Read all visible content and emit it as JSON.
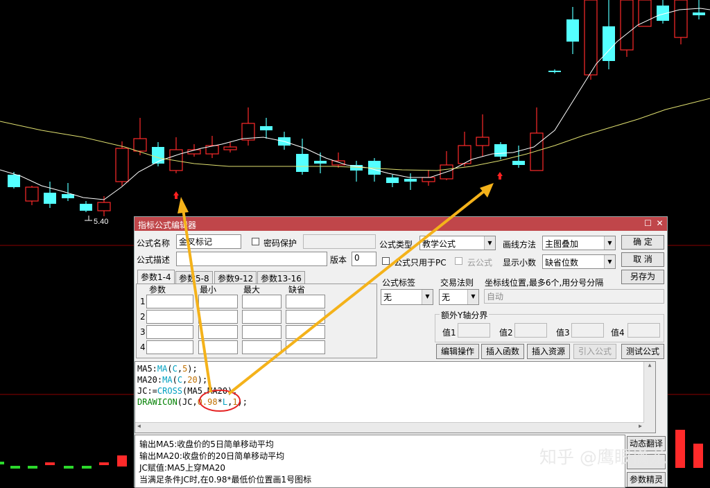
{
  "chart": {
    "low_price_label": "5.40",
    "colors": {
      "up": "#ff2a2a",
      "down": "#54ffff",
      "ma": "#ffffff",
      "ma20": "#e0e070",
      "signal": "#ff2020",
      "arrow": "#f4b21a",
      "divider": "#8b0000"
    }
  },
  "dialog": {
    "title": "指标公式编辑器",
    "name_label": "公式名称",
    "name_value": "金叉标记",
    "password_label": "密码保护",
    "type_label": "公式类型",
    "type_value": "教学公式",
    "draw_label": "画线方法",
    "draw_value": "主图叠加",
    "ok_label": "确  定",
    "cancel_label": "取  消",
    "saveas_label": "另存为",
    "desc_label": "公式描述",
    "version_label": "版本",
    "version_value": "0",
    "pc_only_label": "公式只用于PC",
    "cloud_label": "云公式",
    "decimals_label": "显示小数",
    "decimals_value": "缺省位数",
    "tabs": [
      "参数1-4",
      "参数5-8",
      "参数9-12",
      "参数13-16"
    ],
    "param_headers": [
      "参数",
      "最小",
      "最大",
      "缺省"
    ],
    "param_rows": [
      "1",
      "2",
      "3",
      "4"
    ],
    "formula_tag_label": "公式标签",
    "formula_tag_value": "无",
    "trade_rule_label": "交易法则",
    "trade_rule_value": "无",
    "axis_label": "坐标线位置,最多6个,用分号分隔",
    "axis_value": "自动",
    "yaxis_group_label": "额外Y轴分界",
    "val_labels": [
      "值1",
      "值2",
      "值3",
      "值4"
    ],
    "buttons": [
      "编辑操作",
      "插入函数",
      "插入资源",
      "引入公式",
      "测试公式"
    ],
    "desc_lines": [
      "输出MA5:收盘价的5日简单移动平均",
      "输出MA20:收盘价的20日简单移动平均",
      "JC赋值:MA5上穿MA20",
      "当满足条件JC时,在0.98*最低价位置画1号图标"
    ],
    "side_buttons": [
      "动态翻译",
      "",
      "参数精灵"
    ]
  },
  "code": {
    "line1": [
      {
        "t": "MA5:",
        "c": "#000"
      },
      {
        "t": "MA",
        "c": "#00a0c0"
      },
      {
        "t": "(",
        "c": "#000"
      },
      {
        "t": "C",
        "c": "#00a0c0"
      },
      {
        "t": ",",
        "c": "#000"
      },
      {
        "t": "5",
        "c": "#c07000"
      },
      {
        "t": ");",
        "c": "#000"
      }
    ],
    "line2": [
      {
        "t": "MA20:",
        "c": "#000"
      },
      {
        "t": "MA",
        "c": "#00a0c0"
      },
      {
        "t": "(",
        "c": "#000"
      },
      {
        "t": "C",
        "c": "#00a0c0"
      },
      {
        "t": ",",
        "c": "#000"
      },
      {
        "t": "20",
        "c": "#c07000"
      },
      {
        "t": ");",
        "c": "#000"
      }
    ],
    "line3": [
      {
        "t": "JC:=",
        "c": "#000"
      },
      {
        "t": "CROSS",
        "c": "#00a0c0"
      },
      {
        "t": "(MA5,MA20);",
        "c": "#000"
      }
    ],
    "line4": [
      {
        "t": "DRAWICON",
        "c": "#008000"
      },
      {
        "t": "(JC,",
        "c": "#000"
      },
      {
        "t": "0.98",
        "c": "#c07000"
      },
      {
        "t": "*",
        "c": "#000"
      },
      {
        "t": "L",
        "c": "#00a0c0"
      },
      {
        "t": ",",
        "c": "#000"
      },
      {
        "t": "1",
        "c": "#c07000"
      },
      {
        "t": ");",
        "c": "#000"
      }
    ]
  },
  "watermark": "知乎 @鹰眼擒龙"
}
